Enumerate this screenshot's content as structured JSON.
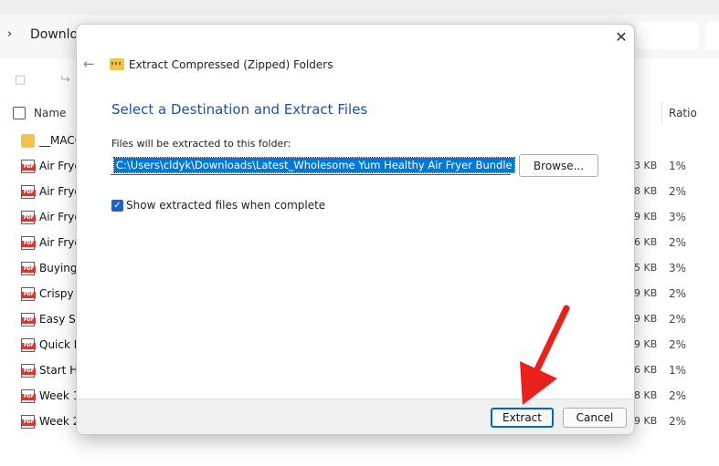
{
  "explorer": {
    "breadcrumb": "Downlo",
    "column_name": "Name",
    "column_ratio": "Ratio",
    "files": [
      {
        "name": "__MACO",
        "type": "folder",
        "size": "",
        "ratio": ""
      },
      {
        "name": "Air Frye",
        "type": "pdf",
        "size": "3 KB",
        "ratio": "1%"
      },
      {
        "name": "Air Frye",
        "type": "pdf",
        "size": "8 KB",
        "ratio": "2%"
      },
      {
        "name": "Air Frye",
        "type": "pdf",
        "size": "9 KB",
        "ratio": "3%"
      },
      {
        "name": "Air Frye",
        "type": "pdf",
        "size": "6 KB",
        "ratio": "2%"
      },
      {
        "name": "Buying",
        "type": "pdf",
        "size": "5 KB",
        "ratio": "3%"
      },
      {
        "name": "Crispy S",
        "type": "pdf",
        "size": "9 KB",
        "ratio": "2%"
      },
      {
        "name": "Easy Sic",
        "type": "pdf",
        "size": "9 KB",
        "ratio": "2%"
      },
      {
        "name": "Quick D",
        "type": "pdf",
        "size": "9 KB",
        "ratio": "2%"
      },
      {
        "name": "Start He",
        "type": "pdf",
        "size": "6 KB",
        "ratio": "1%"
      },
      {
        "name": "Week 1",
        "type": "pdf",
        "size": "8 KB",
        "ratio": "2%"
      },
      {
        "name": "Week 2",
        "type": "pdf",
        "size": "9 KB",
        "ratio": "2%"
      }
    ]
  },
  "dialog": {
    "title": "Extract Compressed (Zipped) Folders",
    "heading": "Select a Destination and Extract Files",
    "folder_label": "Files will be extracted to this folder:",
    "destination_path": "C:\\Users\\cldyk\\Downloads\\Latest_Wholesome Yum Healthy Air Fryer Bundle",
    "browse_label": "Browse...",
    "show_files_label": "Show extracted files when complete",
    "show_files_checked": true,
    "extract_label": "Extract",
    "cancel_label": "Cancel",
    "close_glyph": "✕",
    "back_glyph": "←",
    "check_glyph": "✓"
  },
  "colors": {
    "accent": "#0067c0",
    "heading": "#1f4fa8",
    "selection": "#0078d7",
    "annotation_arrow": "#e8221b"
  },
  "icons": {
    "zip_folder": "zip-folder-icon",
    "pdf": "pdf-file-icon",
    "folder": "folder-icon"
  }
}
